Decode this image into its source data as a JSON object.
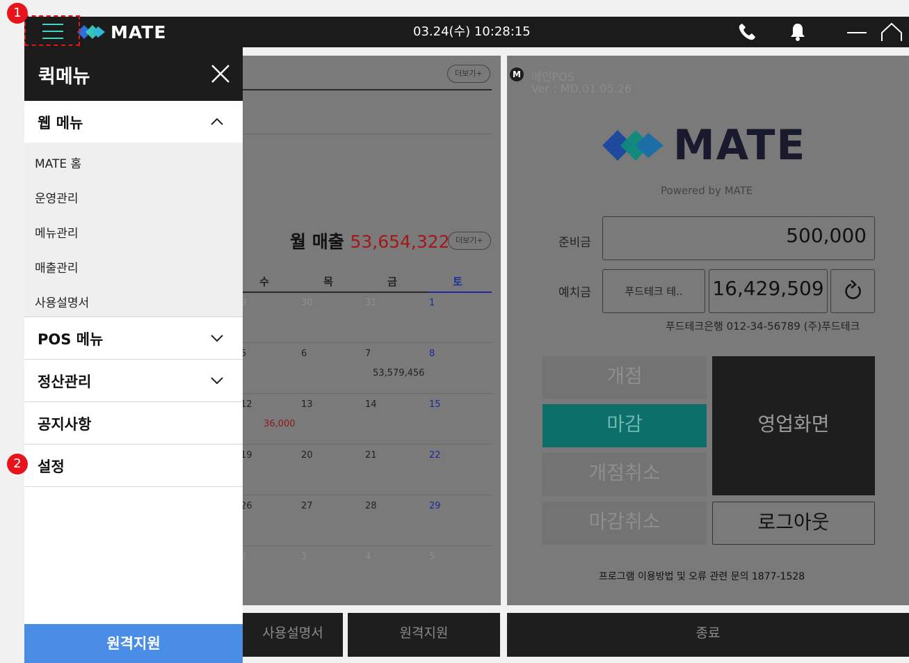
{
  "topbar": {
    "logo": "MATE",
    "datetime": "03.24(수) 10:28:15",
    "icons": [
      "menu-icon",
      "phone-icon",
      "bell-icon",
      "minimize-icon",
      "home-icon"
    ],
    "accent": "#3ed6c4"
  },
  "annotations": {
    "marker1": "1",
    "marker2": "2",
    "color": "#e8141c"
  },
  "quick_menu": {
    "title": "퀵메뉴",
    "sections": [
      {
        "label": "웹 메뉴",
        "expanded": true,
        "items": [
          "MATE 홈",
          "운영관리",
          "메뉴관리",
          "매출관리",
          "사용설명서"
        ]
      },
      {
        "label": "POS 메뉴",
        "expanded": false
      },
      {
        "label": "정산관리",
        "expanded": false
      },
      {
        "label": "공지사항"
      },
      {
        "label": "설정"
      }
    ],
    "remote_button": "원격지원",
    "remote_color": "#4a8de6"
  },
  "dashboard": {
    "more_label": "더보기+",
    "monthly_label": "월 매출",
    "monthly_amount": "53,654,322",
    "weekdays": [
      "수",
      "목",
      "금",
      "토"
    ],
    "calendar_rows": [
      {
        "days": [
          "9",
          "30",
          "31",
          "1"
        ],
        "faded": [
          true,
          true,
          true,
          false
        ]
      },
      {
        "days": [
          "5",
          "6",
          "7",
          "8"
        ],
        "amount": "53,579,456",
        "amount_col": 2
      },
      {
        "days": [
          "12",
          "13",
          "14",
          "15"
        ],
        "amount": "36,000",
        "amount_col": 0
      },
      {
        "days": [
          "19",
          "20",
          "21",
          "22"
        ]
      },
      {
        "days": [
          "26",
          "27",
          "28",
          "29"
        ]
      },
      {
        "days": [
          "2",
          "3",
          "4",
          "5"
        ],
        "faded": [
          true,
          true,
          true,
          true
        ]
      }
    ],
    "bottom_buttons": [
      "사용설명서",
      "원격지원"
    ]
  },
  "pos": {
    "badge": "M",
    "name": "메인POS",
    "version": "Ver : MD.01.05.26",
    "logo": "MATE",
    "powered": "Powered by MATE",
    "reserve_label": "준비금",
    "reserve_value": "500,000",
    "deposit_label": "예치금",
    "deposit_bank": "푸드테크 테..",
    "deposit_value": "16,429,509",
    "account_info": "푸드테크은행 012-34-56789 (주)푸드테크",
    "buttons": {
      "open": "개점",
      "close": "마감",
      "cancel_open": "개점취소",
      "cancel_close": "마감취소",
      "sales": "영업화면",
      "logout": "로그아웃"
    },
    "inquiry": "프로그램 이용방법 및 오류 관련 문의 1877-1528",
    "exit": "종료"
  }
}
